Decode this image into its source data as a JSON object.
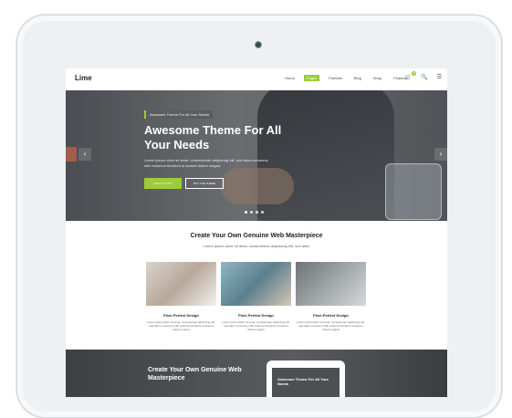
{
  "site": {
    "logo": "Lime",
    "menu": [
      "Home",
      "Pages",
      "Portfolio",
      "Blog",
      "Shop",
      "Features"
    ],
    "active_menu": "Pages",
    "cart_count": "0"
  },
  "hero": {
    "tag": "Awesome Theme For All Your Needs",
    "title": "Awesome Theme For All Your Needs",
    "text": "Lorem ipsum dolor sit amet, consectetuer adipiscing elit, sed diam nonummy nibh euismod tincidunt ut laoreet dolore magna",
    "btn_primary": "CHECK IT OUT",
    "btn_secondary": "BUY THE THEME"
  },
  "section": {
    "title": "Create Your Own Genuine Web Masterpiece",
    "subtitle": "Lorem ipsum dolor sit amet, consectetuer adipiscing elit, sed diam",
    "cards": [
      {
        "title": "Pixel-Perfect Design",
        "desc": "Lorem ipsum dolor sit amet, consectetuer adipiscing elit, sed diam nonummy nibh euismod tincidunt ut laoreet dolore magna"
      },
      {
        "title": "Pixel-Perfect Design",
        "desc": "Lorem ipsum dolor sit amet, consectetuer adipiscing elit, sed diam nonummy nibh euismod tincidunt ut laoreet dolore magna"
      },
      {
        "title": "Pixel-Perfect Design",
        "desc": "Lorem ipsum dolor sit amet, consectetuer adipiscing elit, sed diam nonummy nibh euismod tincidunt ut laoreet dolore magna"
      }
    ]
  },
  "bottom": {
    "title": "Create Your Own Genuine Web Masterpiece",
    "mini_title": "Awesome Theme For All Your Needs"
  },
  "colors": {
    "accent": "#9ccb3b"
  }
}
